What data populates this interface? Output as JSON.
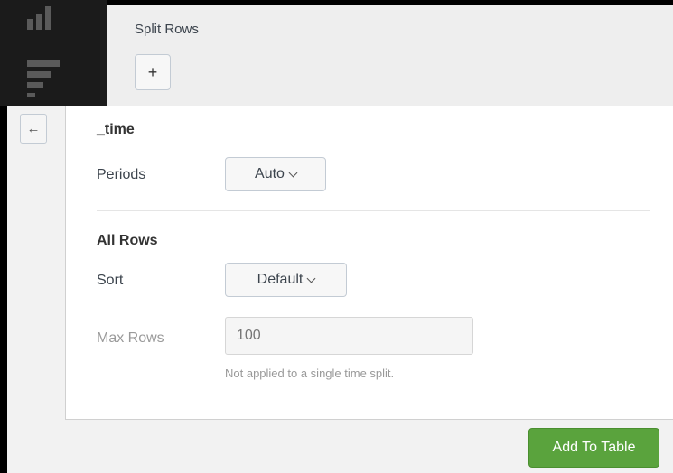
{
  "header": {
    "split_label": "Split Rows",
    "add_split_glyph": "+"
  },
  "panel": {
    "back_glyph": "←",
    "field_section": {
      "title": "_time",
      "periods_label": "Periods",
      "periods_value": "Auto"
    },
    "all_rows_section": {
      "title": "All Rows",
      "sort_label": "Sort",
      "sort_value": "Default",
      "max_rows_label": "Max Rows",
      "max_rows_placeholder": "100",
      "max_rows_help": "Not applied to a single time split."
    }
  },
  "footer": {
    "add_button_label": "Add To Table"
  },
  "icons": {
    "rail_top": "bar-chart-icon",
    "rail_second": "list-icon",
    "back": "arrow-left-icon",
    "dropdown": "chevron-down-icon"
  },
  "colors": {
    "rail_bg": "#1b1b1b",
    "header_bg": "#eeeeee",
    "primary_button": "#5aa33d"
  }
}
